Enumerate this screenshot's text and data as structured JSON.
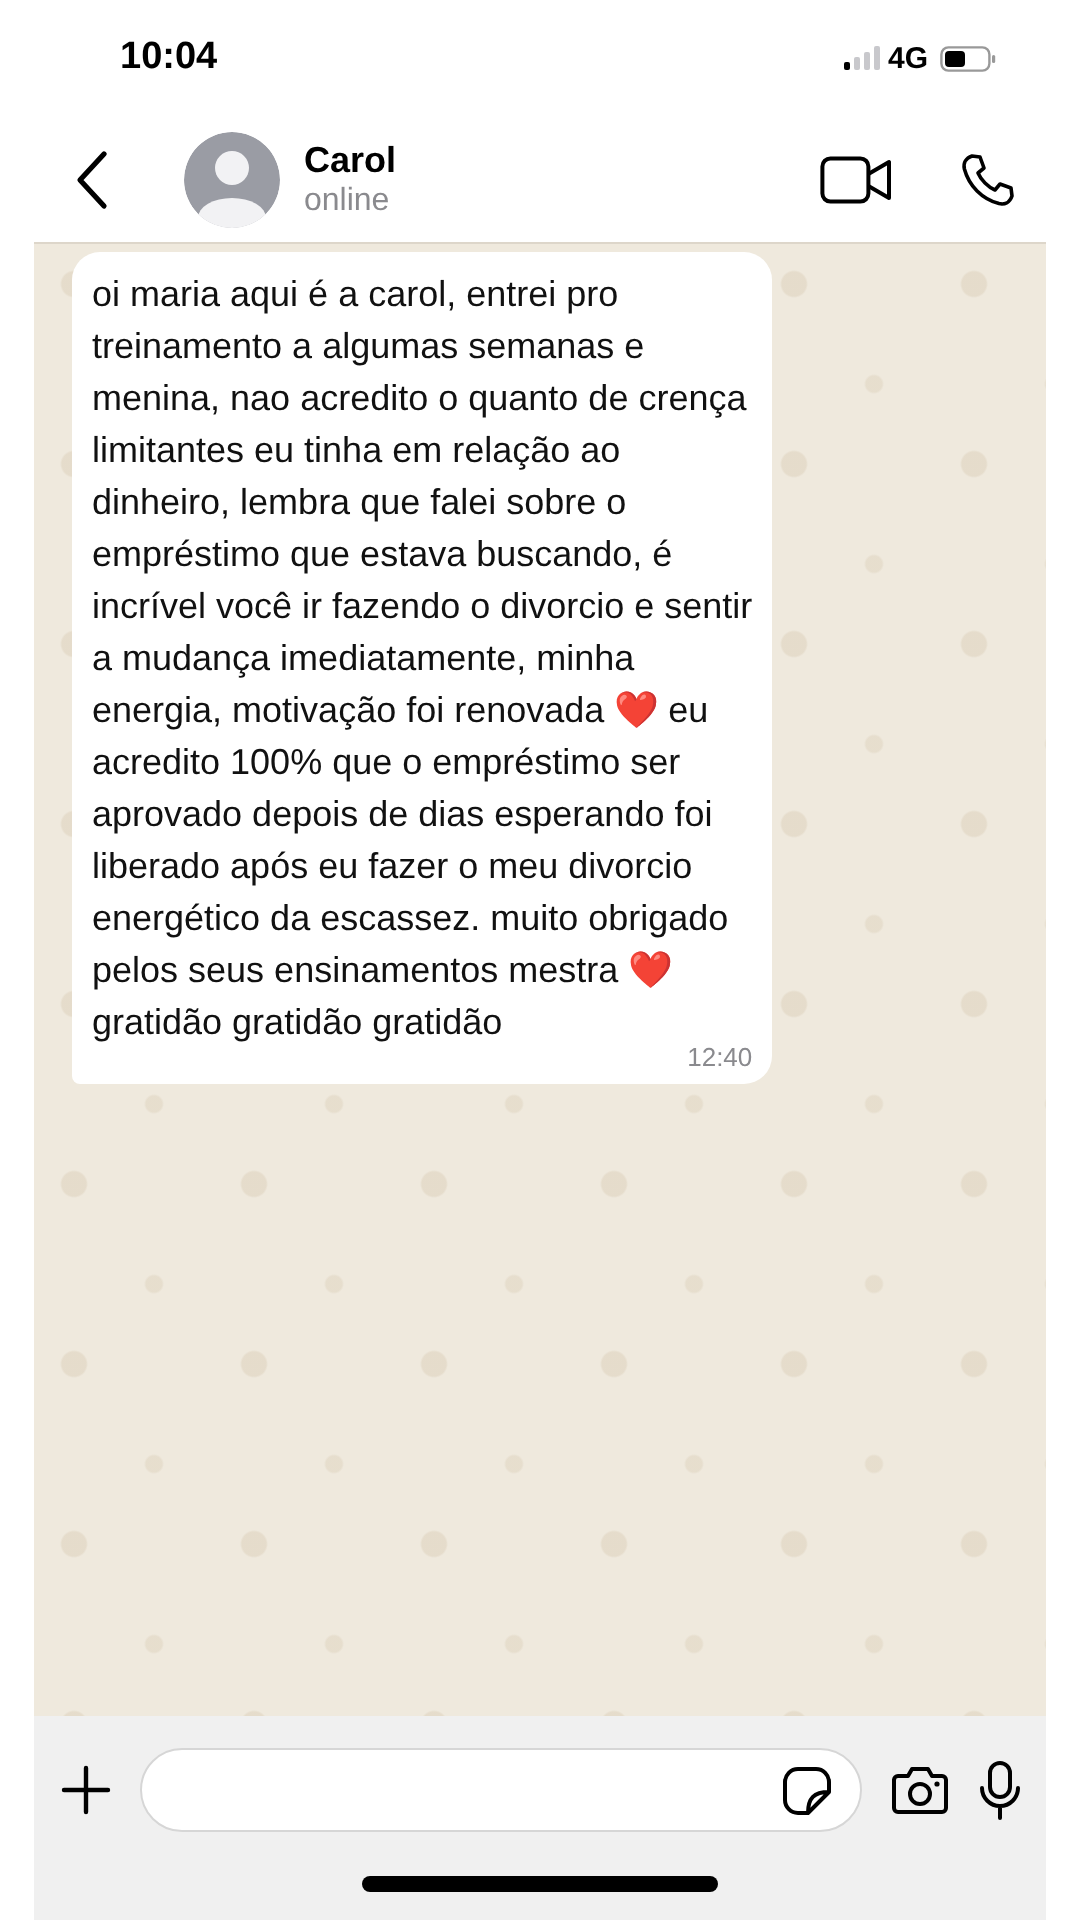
{
  "status_bar": {
    "time": "10:04",
    "network": "4G"
  },
  "contact": {
    "name": "Carol",
    "status": "online"
  },
  "messages": [
    {
      "kind": "incoming",
      "text": "oi maria aqui é a carol, entrei pro\ntreinamento a algumas semanas e\nmenina, nao acredito o quanto de crença\nlimitantes eu tinha em relação ao\ndinheiro, lembra que falei sobre o\nempréstimo que estava buscando, é\nincrível você ir fazendo o divorcio e sentir\na mudança imediatamente, minha\nenergia, motivação foi renovada ❤️ eu\nacredito 100% que o empréstimo ser\naprovado depois de dias esperando foi\nliberado após eu fazer o meu divorcio\nenergético da escassez. muito obrigado\npelos seus ensinamentos mestra ❤️\ngratidão gratidão gratidão",
      "time": "12:40"
    }
  ]
}
